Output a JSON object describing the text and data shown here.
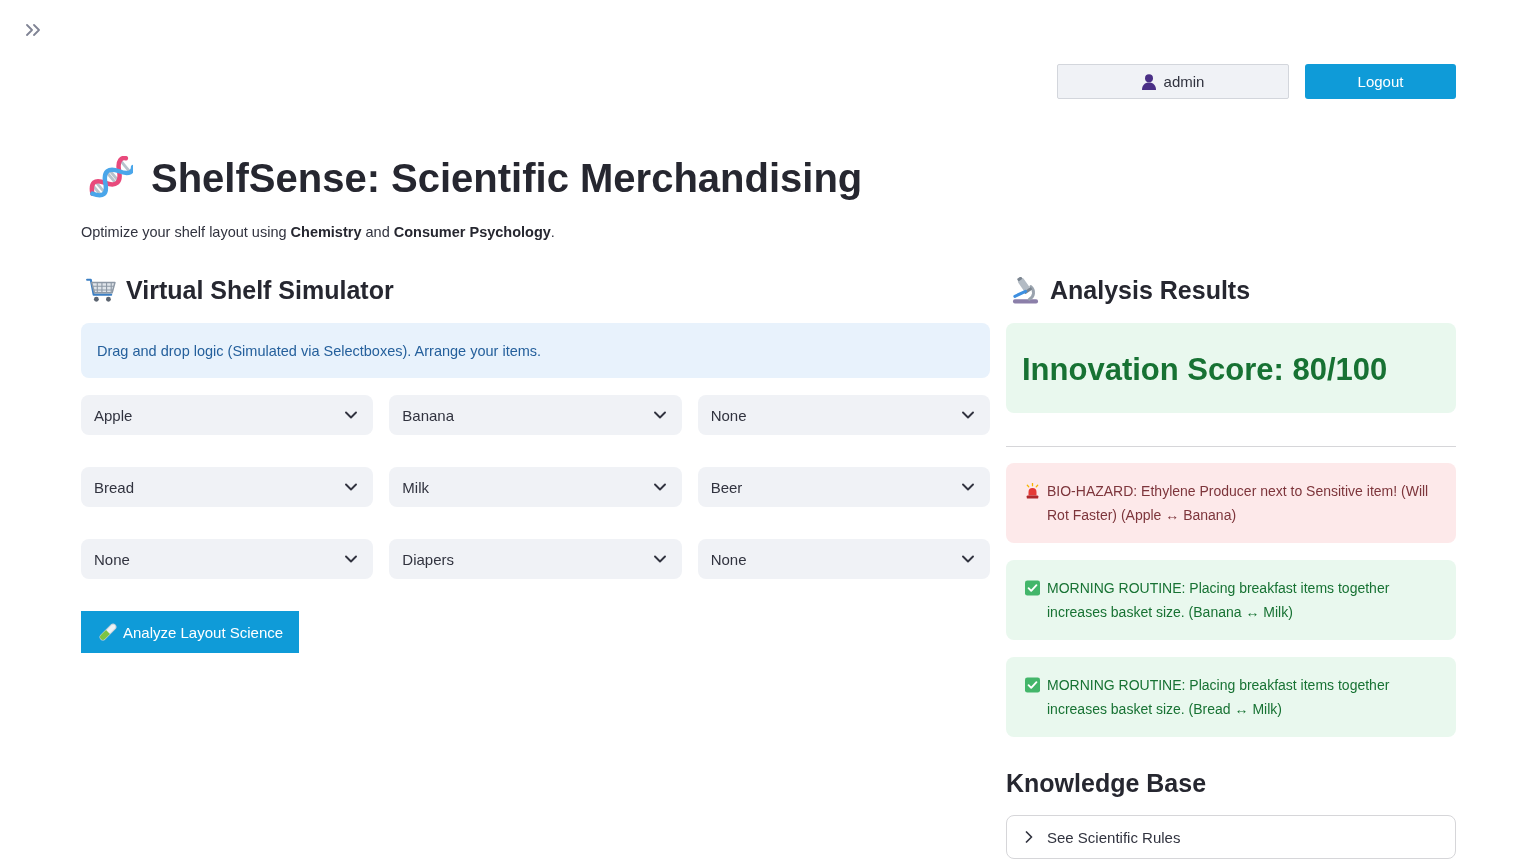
{
  "header": {
    "user_button": "admin",
    "logout_button": "Logout"
  },
  "title": "ShelfSense: Scientific Merchandising",
  "subtitle": "Optimize your shelf layout using **Chemistry** and **Consumer Psychology**.",
  "simulator": {
    "heading": "Virtual Shelf Simulator",
    "info": "Drag and drop logic (Simulated via Selectboxes). Arrange your items.",
    "shelf_rows": [
      [
        "Apple",
        "Banana",
        "None"
      ],
      [
        "Bread",
        "Milk",
        "Beer"
      ],
      [
        "None",
        "Diapers",
        "None"
      ]
    ],
    "analyze_button": "Analyze Layout Science"
  },
  "results": {
    "heading": "Analysis Results",
    "score": "Innovation Score: 80/100",
    "alerts": [
      {
        "kind": "error",
        "text": "BIO-HAZARD: Ethylene Producer next to Sensitive item! (Will Rot Faster) (Apple ↔ Banana)"
      },
      {
        "kind": "success",
        "text": "MORNING ROUTINE: Placing breakfast items together increases basket size. (Banana ↔ Milk)"
      },
      {
        "kind": "success",
        "text": "MORNING ROUTINE: Placing breakfast items together increases basket size. (Bread ↔ Milk)"
      }
    ]
  },
  "knowledge_base": {
    "heading": "Knowledge Base",
    "expander": {
      "label": "See Scientific Rules",
      "expanded": false
    }
  }
}
